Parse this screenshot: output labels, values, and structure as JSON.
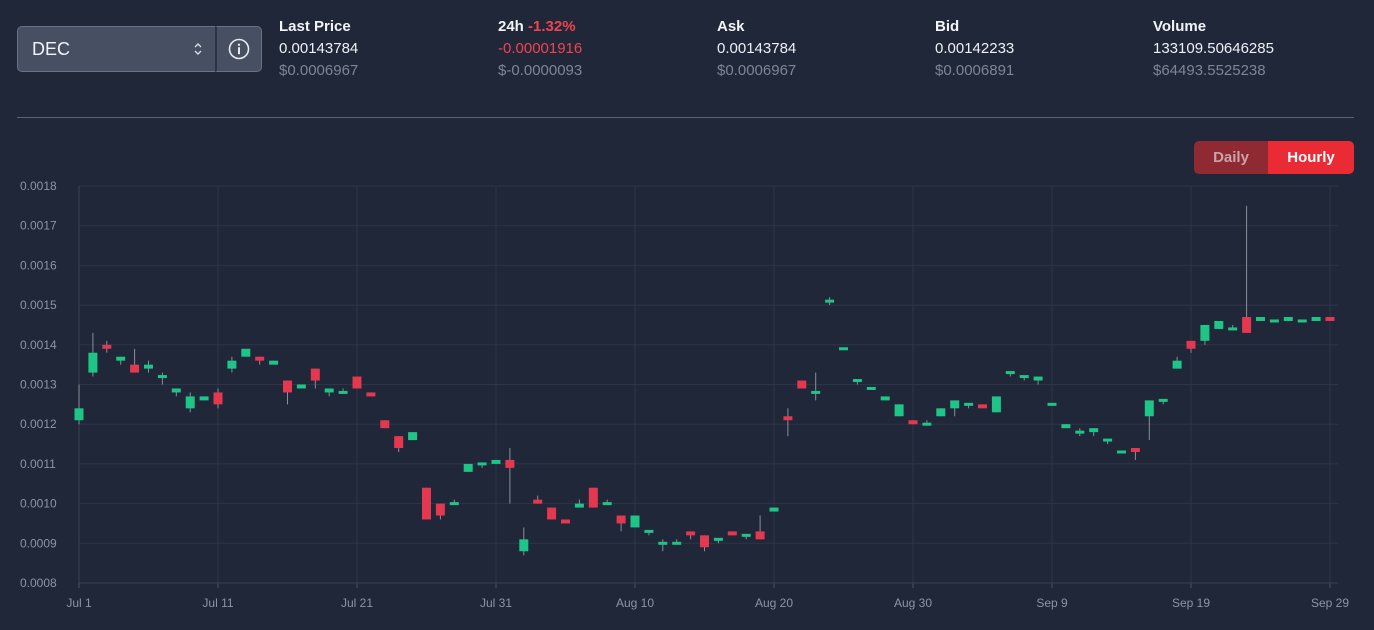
{
  "token_select": {
    "value": "DEC"
  },
  "stats": {
    "last_price": {
      "label": "Last Price",
      "value": "0.00143784",
      "usd": "$0.0006967"
    },
    "change_24h": {
      "label": "24h",
      "pct": "-1.32%",
      "value": "-0.00001916",
      "usd": "$-0.0000093"
    },
    "ask": {
      "label": "Ask",
      "value": "0.00143784",
      "usd": "$0.0006967"
    },
    "bid": {
      "label": "Bid",
      "value": "0.00142233",
      "usd": "$0.0006891"
    },
    "volume": {
      "label": "Volume",
      "value": "133109.50646285",
      "usd": "$64493.5525238"
    }
  },
  "toggle": {
    "daily": "Daily",
    "hourly": "Hourly",
    "active": "Hourly"
  },
  "colors": {
    "up": "#1ec586",
    "down": "#e43750",
    "background": "#1f2739",
    "grid": "#2d3648"
  },
  "chart_data": {
    "type": "candlestick",
    "ylim": [
      0.0008,
      0.0018
    ],
    "y_ticks": [
      "0.0018",
      "0.0017",
      "0.0016",
      "0.0015",
      "0.0014",
      "0.0013",
      "0.0012",
      "0.0011",
      "0.0010",
      "0.0009",
      "0.0008"
    ],
    "x_ticks": [
      {
        "label": "Jul 1",
        "day": 0
      },
      {
        "label": "Jul 11",
        "day": 10
      },
      {
        "label": "Jul 21",
        "day": 20
      },
      {
        "label": "Jul 31",
        "day": 30
      },
      {
        "label": "Aug 10",
        "day": 40
      },
      {
        "label": "Aug 20",
        "day": 50
      },
      {
        "label": "Aug 30",
        "day": 60
      },
      {
        "label": "Sep 9",
        "day": 70
      },
      {
        "label": "Sep 19",
        "day": 80
      },
      {
        "label": "Sep 29",
        "day": 90
      }
    ],
    "candles": [
      {
        "day": 0,
        "o": 0.00121,
        "h": 0.0013,
        "l": 0.0012,
        "c": 0.00124
      },
      {
        "day": 1,
        "o": 0.00133,
        "h": 0.00143,
        "l": 0.00132,
        "c": 0.00138
      },
      {
        "day": 2,
        "o": 0.0014,
        "h": 0.00141,
        "l": 0.00138,
        "c": 0.00139
      },
      {
        "day": 3,
        "o": 0.00136,
        "h": 0.00137,
        "l": 0.00135,
        "c": 0.00137
      },
      {
        "day": 4,
        "o": 0.00135,
        "h": 0.00139,
        "l": 0.00133,
        "c": 0.00133
      },
      {
        "day": 5,
        "o": 0.00134,
        "h": 0.00136,
        "l": 0.00133,
        "c": 0.00135
      },
      {
        "day": 6,
        "o": 0.00132,
        "h": 0.00133,
        "l": 0.0013,
        "c": 0.00132
      },
      {
        "day": 7,
        "o": 0.00128,
        "h": 0.00129,
        "l": 0.00127,
        "c": 0.00129
      },
      {
        "day": 8,
        "o": 0.00124,
        "h": 0.00128,
        "l": 0.00123,
        "c": 0.00127
      },
      {
        "day": 9,
        "o": 0.00126,
        "h": 0.00127,
        "l": 0.00126,
        "c": 0.00127
      },
      {
        "day": 10,
        "o": 0.00128,
        "h": 0.00129,
        "l": 0.00124,
        "c": 0.00125
      },
      {
        "day": 11,
        "o": 0.00134,
        "h": 0.00137,
        "l": 0.00133,
        "c": 0.00136
      },
      {
        "day": 12,
        "o": 0.00137,
        "h": 0.00139,
        "l": 0.00137,
        "c": 0.00139
      },
      {
        "day": 13,
        "o": 0.00137,
        "h": 0.00137,
        "l": 0.00135,
        "c": 0.00136
      },
      {
        "day": 14,
        "o": 0.00135,
        "h": 0.00136,
        "l": 0.00135,
        "c": 0.00136
      },
      {
        "day": 15,
        "o": 0.00131,
        "h": 0.00131,
        "l": 0.00125,
        "c": 0.00128
      },
      {
        "day": 16,
        "o": 0.00129,
        "h": 0.0013,
        "l": 0.00129,
        "c": 0.0013
      },
      {
        "day": 17,
        "o": 0.00134,
        "h": 0.00134,
        "l": 0.00129,
        "c": 0.00131
      },
      {
        "day": 18,
        "o": 0.00128,
        "h": 0.00129,
        "l": 0.00127,
        "c": 0.00129
      },
      {
        "day": 19,
        "o": 0.00128,
        "h": 0.00129,
        "l": 0.00128,
        "c": 0.00128
      },
      {
        "day": 20,
        "o": 0.00132,
        "h": 0.00132,
        "l": 0.00129,
        "c": 0.00129
      },
      {
        "day": 21,
        "o": 0.00128,
        "h": 0.00128,
        "l": 0.00127,
        "c": 0.00127
      },
      {
        "day": 22,
        "o": 0.00121,
        "h": 0.00121,
        "l": 0.00119,
        "c": 0.00119
      },
      {
        "day": 23,
        "o": 0.00117,
        "h": 0.00117,
        "l": 0.00113,
        "c": 0.00114
      },
      {
        "day": 24,
        "o": 0.00116,
        "h": 0.00118,
        "l": 0.00116,
        "c": 0.00118
      },
      {
        "day": 25,
        "o": 0.00104,
        "h": 0.00104,
        "l": 0.00096,
        "c": 0.00096
      },
      {
        "day": 26,
        "o": 0.001,
        "h": 0.001,
        "l": 0.00096,
        "c": 0.00097
      },
      {
        "day": 27,
        "o": 0.001,
        "h": 0.00101,
        "l": 0.001,
        "c": 0.001
      },
      {
        "day": 28,
        "o": 0.00108,
        "h": 0.0011,
        "l": 0.00108,
        "c": 0.0011
      },
      {
        "day": 29,
        "o": 0.0011,
        "h": 0.0011,
        "l": 0.00109,
        "c": 0.0011
      },
      {
        "day": 30,
        "o": 0.0011,
        "h": 0.00111,
        "l": 0.0011,
        "c": 0.00111
      },
      {
        "day": 31,
        "o": 0.00111,
        "h": 0.00114,
        "l": 0.001,
        "c": 0.00109
      },
      {
        "day": 32,
        "o": 0.00088,
        "h": 0.00094,
        "l": 0.00087,
        "c": 0.00091
      },
      {
        "day": 33,
        "o": 0.00101,
        "h": 0.00102,
        "l": 0.001,
        "c": 0.001
      },
      {
        "day": 34,
        "o": 0.00099,
        "h": 0.00099,
        "l": 0.00096,
        "c": 0.00096
      },
      {
        "day": 35,
        "o": 0.00096,
        "h": 0.00096,
        "l": 0.00095,
        "c": 0.00095
      },
      {
        "day": 36,
        "o": 0.00099,
        "h": 0.00101,
        "l": 0.00099,
        "c": 0.001
      },
      {
        "day": 37,
        "o": 0.00104,
        "h": 0.00104,
        "l": 0.00099,
        "c": 0.00099
      },
      {
        "day": 38,
        "o": 0.001,
        "h": 0.00101,
        "l": 0.001,
        "c": 0.001
      },
      {
        "day": 39,
        "o": 0.00097,
        "h": 0.00097,
        "l": 0.00093,
        "c": 0.00095
      },
      {
        "day": 40,
        "o": 0.00094,
        "h": 0.00097,
        "l": 0.00094,
        "c": 0.00097
      },
      {
        "day": 41,
        "o": 0.00093,
        "h": 0.00093,
        "l": 0.00092,
        "c": 0.00093
      },
      {
        "day": 42,
        "o": 0.0009,
        "h": 0.00091,
        "l": 0.00088,
        "c": 0.0009
      },
      {
        "day": 43,
        "o": 0.0009,
        "h": 0.00091,
        "l": 0.0009,
        "c": 0.0009
      },
      {
        "day": 44,
        "o": 0.00093,
        "h": 0.00093,
        "l": 0.00091,
        "c": 0.00092
      },
      {
        "day": 45,
        "o": 0.00092,
        "h": 0.00092,
        "l": 0.00088,
        "c": 0.00089
      },
      {
        "day": 46,
        "o": 0.00091,
        "h": 0.00091,
        "l": 0.0009,
        "c": 0.00091
      },
      {
        "day": 47,
        "o": 0.00093,
        "h": 0.00093,
        "l": 0.00092,
        "c": 0.00092
      },
      {
        "day": 48,
        "o": 0.00092,
        "h": 0.00092,
        "l": 0.00091,
        "c": 0.00092
      },
      {
        "day": 49,
        "o": 0.00093,
        "h": 0.00097,
        "l": 0.00091,
        "c": 0.00091
      },
      {
        "day": 50,
        "o": 0.00098,
        "h": 0.00099,
        "l": 0.00098,
        "c": 0.00099
      },
      {
        "day": 51,
        "o": 0.00122,
        "h": 0.00124,
        "l": 0.00117,
        "c": 0.00121
      },
      {
        "day": 52,
        "o": 0.00131,
        "h": 0.00131,
        "l": 0.00129,
        "c": 0.00129
      },
      {
        "day": 53,
        "o": 0.00128,
        "h": 0.00133,
        "l": 0.00126,
        "c": 0.00128
      },
      {
        "day": 54,
        "o": 0.00151,
        "h": 0.00152,
        "l": 0.0015,
        "c": 0.00151
      },
      {
        "day": 55,
        "o": 0.00139,
        "h": 0.00139,
        "l": 0.00139,
        "c": 0.00139
      },
      {
        "day": 56,
        "o": 0.00131,
        "h": 0.00131,
        "l": 0.0013,
        "c": 0.00131
      },
      {
        "day": 57,
        "o": 0.00129,
        "h": 0.00129,
        "l": 0.00129,
        "c": 0.00129
      },
      {
        "day": 58,
        "o": 0.00126,
        "h": 0.00127,
        "l": 0.00126,
        "c": 0.00127
      },
      {
        "day": 59,
        "o": 0.00122,
        "h": 0.00125,
        "l": 0.00122,
        "c": 0.00125
      },
      {
        "day": 60,
        "o": 0.00121,
        "h": 0.00121,
        "l": 0.0012,
        "c": 0.0012
      },
      {
        "day": 61,
        "o": 0.0012,
        "h": 0.00121,
        "l": 0.0012,
        "c": 0.0012
      },
      {
        "day": 62,
        "o": 0.00122,
        "h": 0.00124,
        "l": 0.00122,
        "c": 0.00124
      },
      {
        "day": 63,
        "o": 0.00124,
        "h": 0.00126,
        "l": 0.00122,
        "c": 0.00126
      },
      {
        "day": 64,
        "o": 0.00125,
        "h": 0.00125,
        "l": 0.00124,
        "c": 0.00125
      },
      {
        "day": 65,
        "o": 0.00125,
        "h": 0.00125,
        "l": 0.00124,
        "c": 0.00124
      },
      {
        "day": 66,
        "o": 0.00123,
        "h": 0.00127,
        "l": 0.00123,
        "c": 0.00127
      },
      {
        "day": 67,
        "o": 0.00133,
        "h": 0.00133,
        "l": 0.00132,
        "c": 0.00133
      },
      {
        "day": 68,
        "o": 0.00132,
        "h": 0.00132,
        "l": 0.00131,
        "c": 0.00132
      },
      {
        "day": 69,
        "o": 0.00131,
        "h": 0.00132,
        "l": 0.0013,
        "c": 0.00132
      },
      {
        "day": 70,
        "o": 0.00125,
        "h": 0.00125,
        "l": 0.00125,
        "c": 0.00125
      },
      {
        "day": 71,
        "o": 0.00119,
        "h": 0.0012,
        "l": 0.00119,
        "c": 0.0012
      },
      {
        "day": 72,
        "o": 0.00118,
        "h": 0.00119,
        "l": 0.00117,
        "c": 0.00118
      },
      {
        "day": 73,
        "o": 0.00118,
        "h": 0.00119,
        "l": 0.00117,
        "c": 0.00119
      },
      {
        "day": 74,
        "o": 0.00116,
        "h": 0.00116,
        "l": 0.00115,
        "c": 0.00116
      },
      {
        "day": 75,
        "o": 0.00113,
        "h": 0.00113,
        "l": 0.00113,
        "c": 0.00113
      },
      {
        "day": 76,
        "o": 0.00114,
        "h": 0.00114,
        "l": 0.00111,
        "c": 0.00113
      },
      {
        "day": 77,
        "o": 0.00122,
        "h": 0.00126,
        "l": 0.00116,
        "c": 0.00126
      },
      {
        "day": 78,
        "o": 0.00126,
        "h": 0.00126,
        "l": 0.00125,
        "c": 0.00126
      },
      {
        "day": 79,
        "o": 0.00134,
        "h": 0.00137,
        "l": 0.00134,
        "c": 0.00136
      },
      {
        "day": 80,
        "o": 0.00141,
        "h": 0.00141,
        "l": 0.00138,
        "c": 0.00139
      },
      {
        "day": 81,
        "o": 0.00141,
        "h": 0.00145,
        "l": 0.0014,
        "c": 0.00145
      },
      {
        "day": 82,
        "o": 0.00144,
        "h": 0.00146,
        "l": 0.00144,
        "c": 0.00146
      },
      {
        "day": 83,
        "o": 0.00144,
        "h": 0.00145,
        "l": 0.00144,
        "c": 0.00144
      },
      {
        "day": 84,
        "o": 0.00147,
        "h": 0.00175,
        "l": 0.00143,
        "c": 0.00143
      },
      {
        "day": 85,
        "o": 0.00146,
        "h": 0.00147,
        "l": 0.00146,
        "c": 0.00147
      },
      {
        "day": 86,
        "o": 0.00146,
        "h": 0.00146,
        "l": 0.00146,
        "c": 0.00146
      },
      {
        "day": 87,
        "o": 0.00146,
        "h": 0.00147,
        "l": 0.00146,
        "c": 0.00147
      },
      {
        "day": 88,
        "o": 0.00146,
        "h": 0.00146,
        "l": 0.00146,
        "c": 0.00146
      },
      {
        "day": 89,
        "o": 0.00146,
        "h": 0.00147,
        "l": 0.00146,
        "c": 0.00147
      },
      {
        "day": 90,
        "o": 0.00147,
        "h": 0.00147,
        "l": 0.00146,
        "c": 0.00146
      }
    ]
  }
}
